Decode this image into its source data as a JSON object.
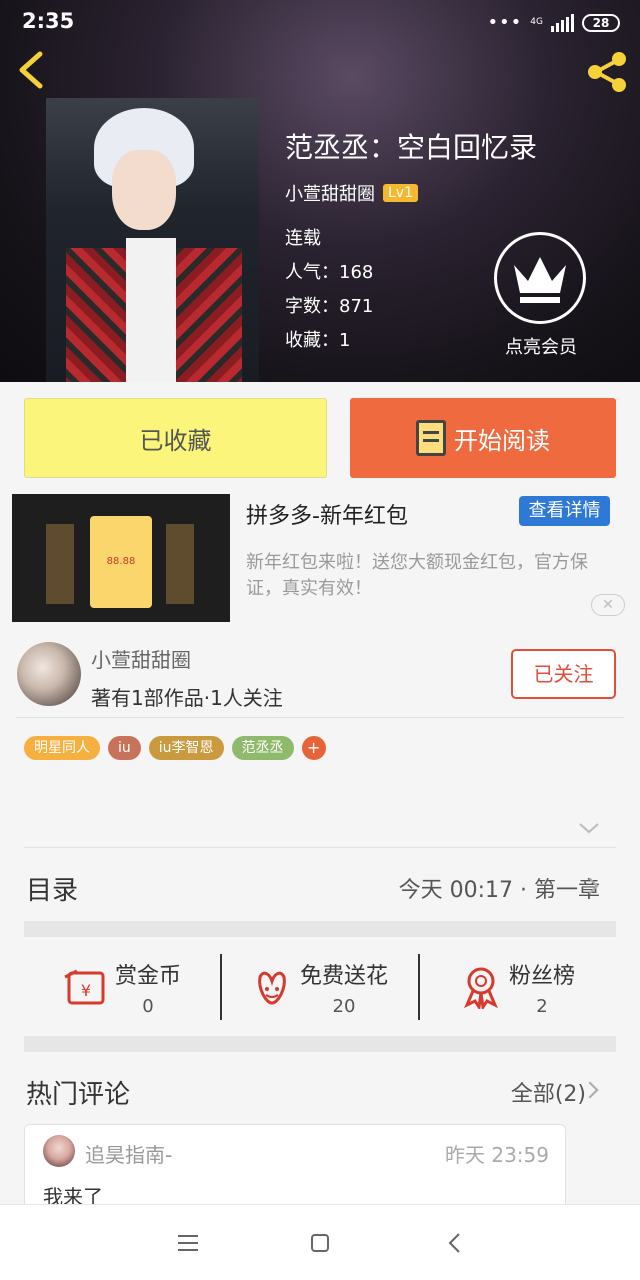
{
  "status": {
    "time": "2:35",
    "network": "4G",
    "battery": "28"
  },
  "book": {
    "title": "范丞丞：空白回忆录",
    "author": "小萱甜甜圈",
    "level": "Lv1",
    "status_text": "连载",
    "popularity": "人气：168",
    "word_count": "字数：871",
    "favorites": "收藏：1"
  },
  "vip": {
    "label": "点亮会员"
  },
  "actions": {
    "favorited_label": "已收藏",
    "read_label": "开始阅读"
  },
  "ad": {
    "title": "拼多多-新年红包",
    "detail_button": "查看详情",
    "description": "新年红包来啦！送您大额现金红包，官方保证，真实有效！",
    "card_amount": "88.88",
    "close_glyph": "✕"
  },
  "author_block": {
    "name": "小萱甜甜圈",
    "stats": "著有1部作品·1人关注",
    "follow_label": "已关注"
  },
  "tags": [
    {
      "label": "明星同人",
      "color": "#f5b040"
    },
    {
      "label": "iu",
      "color": "#c7725b"
    },
    {
      "label": "iu李智恩",
      "color": "#c99a3e"
    },
    {
      "label": "范丞丞",
      "color": "#8fb96b"
    }
  ],
  "tag_add": "+",
  "toc": {
    "label": "目录",
    "latest": "今天 00:17 · 第一章"
  },
  "rewards": [
    {
      "label": "赏金币",
      "value": "0",
      "icon": "red-envelope-icon"
    },
    {
      "label": "免费送花",
      "value": "20",
      "icon": "flower-icon"
    },
    {
      "label": "粉丝榜",
      "value": "2",
      "icon": "ribbon-award-icon"
    }
  ],
  "comments": {
    "label": "热门评论",
    "all": "全部(2)",
    "items": [
      {
        "user": "追昊指南-",
        "time": "昨天 23:59",
        "text": "我来了"
      }
    ]
  },
  "colors": {
    "accent_orange": "#ef6a3e",
    "fav_yellow": "#fcf57b",
    "follow_red": "#e14e3a",
    "ad_blue": "#2f79d6"
  }
}
